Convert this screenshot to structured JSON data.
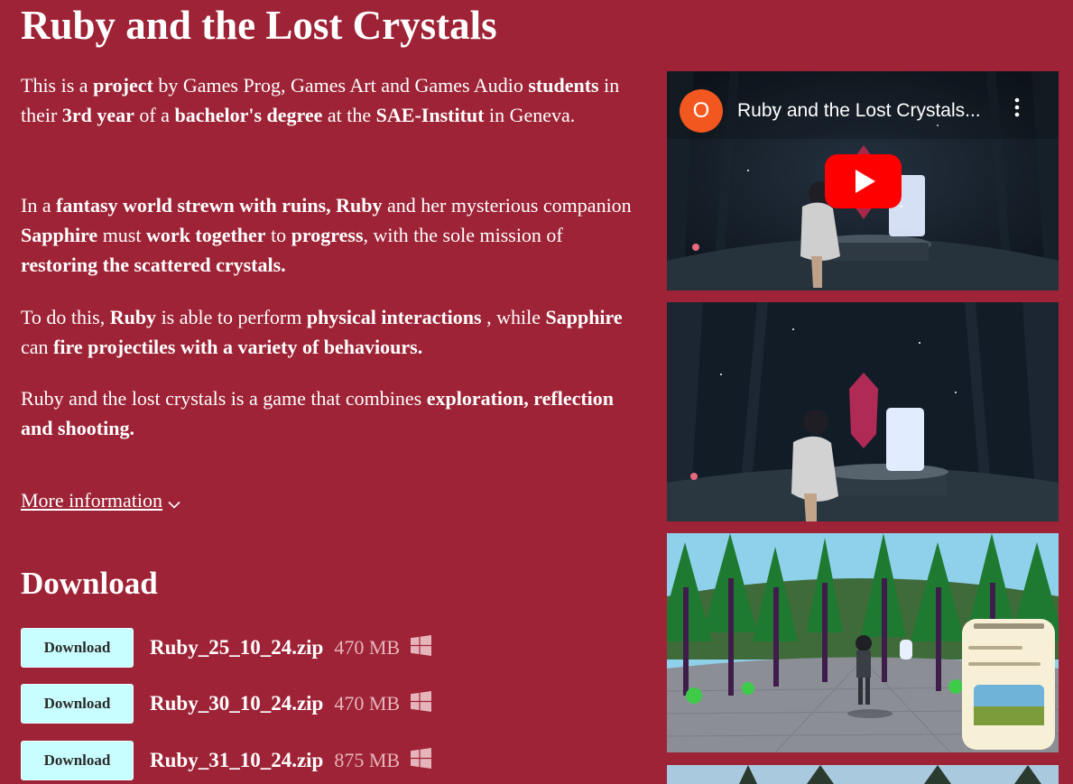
{
  "title": "Ruby and the Lost Crystals",
  "description": {
    "p1": [
      {
        "t": "This is a ",
        "b": false
      },
      {
        "t": "project",
        "b": true
      },
      {
        "t": " by Games Prog, Games Art and Games Audio ",
        "b": false
      },
      {
        "t": "students",
        "b": true
      },
      {
        "t": " in their ",
        "b": false
      },
      {
        "t": "3rd year",
        "b": true
      },
      {
        "t": " of a ",
        "b": false
      },
      {
        "t": "bachelor's degree",
        "b": true
      },
      {
        "t": " at the ",
        "b": false
      },
      {
        "t": "SAE-Institut",
        "b": true
      },
      {
        "t": " in Geneva.",
        "b": false
      }
    ],
    "p2": [
      {
        "t": "In a ",
        "b": false
      },
      {
        "t": "fantasy world strewn with ruins, Ruby",
        "b": true
      },
      {
        "t": " and her mysterious companion ",
        "b": false
      },
      {
        "t": "Sapphire",
        "b": true
      },
      {
        "t": " must ",
        "b": false
      },
      {
        "t": "work together",
        "b": true
      },
      {
        "t": " to ",
        "b": false
      },
      {
        "t": "progress",
        "b": true
      },
      {
        "t": ", with the sole mission of ",
        "b": false
      },
      {
        "t": "restoring the scattered crystals.",
        "b": true
      }
    ],
    "p3": [
      {
        "t": "To do this, ",
        "b": false
      },
      {
        "t": "Ruby",
        "b": true
      },
      {
        "t": " is able to perform ",
        "b": false
      },
      {
        "t": "physical interactions",
        "b": true
      },
      {
        "t": " , while ",
        "b": false
      },
      {
        "t": "Sapphire",
        "b": true
      },
      {
        "t": " can ",
        "b": false
      },
      {
        "t": "fire projectiles with a variety of behaviours.",
        "b": true
      }
    ],
    "p4": [
      {
        "t": "Ruby and the lost crystals is a game that combines ",
        "b": false
      },
      {
        "t": "exploration, reflection and shooting.",
        "b": true
      }
    ]
  },
  "more_info_label": "More information",
  "download_heading": "Download",
  "downloads": [
    {
      "button": "Download",
      "filename": "Ruby_25_10_24.zip",
      "size": "470 MB",
      "platform_icon": "windows-icon"
    },
    {
      "button": "Download",
      "filename": "Ruby_30_10_24.zip",
      "size": "470 MB",
      "platform_icon": "windows-icon"
    },
    {
      "button": "Download",
      "filename": "Ruby_31_10_24.zip",
      "size": "875 MB",
      "platform_icon": "windows-icon"
    }
  ],
  "video": {
    "channel_avatar": "O",
    "title": "Ruby and the Lost Crystals..."
  },
  "colors": {
    "page_bg": "#9e2336",
    "button_bg": "#c8feff",
    "size_text": "#e6b5bc",
    "youtube_red": "#ff0000",
    "avatar_orange": "#f2571f"
  }
}
